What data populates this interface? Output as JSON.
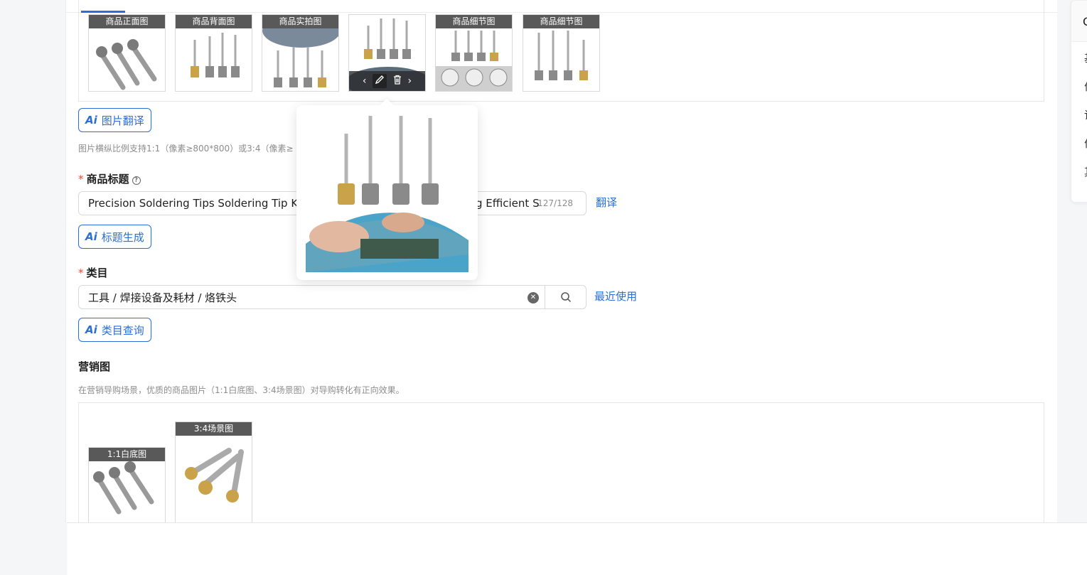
{
  "product_images": {
    "items": [
      {
        "tag": "商品正面图"
      },
      {
        "tag": "商品背面图"
      },
      {
        "tag": "商品实拍图"
      },
      {
        "tag": ""
      },
      {
        "tag": "商品细节图"
      },
      {
        "tag": "商品细节图"
      }
    ],
    "hover_controls": {
      "prev": "‹",
      "next": "›"
    },
    "translate_button": "图片翻译",
    "ratio_hint": "图片横纵比例支持1:1（像素≥800*800）或3:4（像素≥"
  },
  "title_section": {
    "label": "商品标题",
    "value_left": "Precision Soldering Tips Soldering Tip Kit C",
    "value_right": "g Efficient S",
    "count": "127/128",
    "translate_link": "翻译",
    "generate_button": "标题生成"
  },
  "category_section": {
    "label": "类目",
    "value": "工具 / 焊接设备及耗材 / 烙铁头",
    "recent_link": "最近使用",
    "query_button": "类目查询"
  },
  "marketing_section": {
    "label": "营销图",
    "hint": "在营销导购场景，优质的商品图片（1:1白底图、3:4场景图）对导购转化有正向效果。",
    "items": [
      {
        "tag": "1:1白底图"
      },
      {
        "tag": "3:4场景图"
      }
    ]
  },
  "right_panel": {
    "head": "C",
    "items": [
      "基",
      "价",
      "详",
      "价",
      "其"
    ]
  },
  "ai_glyph": "Ai",
  "colors": {
    "accent": "#2a6fd6",
    "required": "#e34d2e"
  }
}
